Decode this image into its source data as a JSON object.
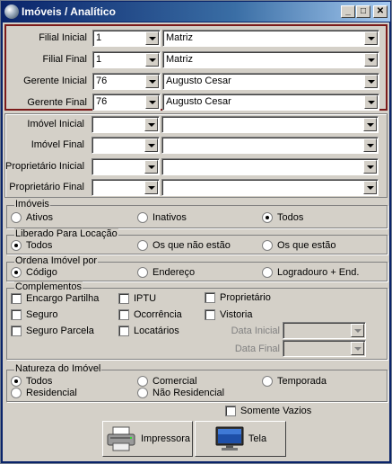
{
  "window": {
    "title": "Imóveis / Analítico",
    "minimize": "_",
    "maximize": "□",
    "close": "✕"
  },
  "filters_top": [
    {
      "label": "Filial Inicial",
      "code": "1",
      "name": "Matriz"
    },
    {
      "label": "Filial Final",
      "code": "1",
      "name": "Matriz"
    },
    {
      "label": "Gerente Inicial",
      "code": "76",
      "name": "Augusto Cesar"
    },
    {
      "label": "Gerente Final",
      "code": "76",
      "name": "Augusto Cesar"
    }
  ],
  "filters_mid": [
    {
      "label": "Imóvel Inicial",
      "code": "",
      "name": ""
    },
    {
      "label": "Imóvel Final",
      "code": "",
      "name": ""
    },
    {
      "label": "Proprietário Inicial",
      "code": "",
      "name": ""
    },
    {
      "label": "Proprietário Final",
      "code": "",
      "name": ""
    }
  ],
  "imoveis": {
    "legend": "Imóveis",
    "options": [
      "Ativos",
      "Inativos",
      "Todos"
    ],
    "selected": 2
  },
  "liberado": {
    "legend": "Liberado Para Locação",
    "options": [
      "Todos",
      "Os que não estão",
      "Os que estão"
    ],
    "selected": 0
  },
  "ordena": {
    "legend": "Ordena Imóvel por",
    "options": [
      "Código",
      "Endereço",
      "Logradouro + End."
    ],
    "selected": 0
  },
  "complementos": {
    "legend": "Complementos",
    "items": [
      "Encargo Partilha",
      "IPTU",
      "Proprietário",
      "Seguro",
      "Ocorrência",
      "Vistoria",
      "Seguro Parcela",
      "Locatários"
    ],
    "data_inicial_label": "Data Inicial",
    "data_final_label": "Data Final"
  },
  "natureza": {
    "legend": "Natureza do Imóvel",
    "options": [
      "Todos",
      "Comercial",
      "Temporada",
      "Residencial",
      "Não Residencial"
    ],
    "selected": 0
  },
  "somente_vazios": "Somente Vazios",
  "buttons": {
    "impressora": "Impressora",
    "tela": "Tela"
  }
}
